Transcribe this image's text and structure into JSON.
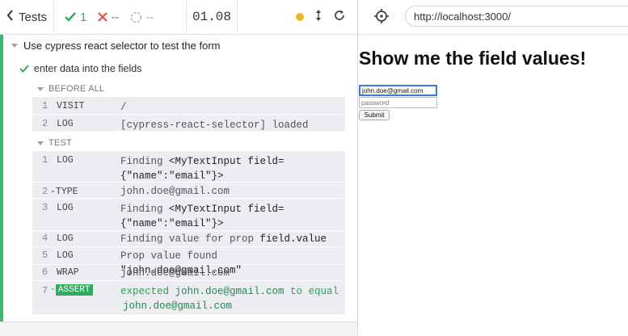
{
  "header": {
    "tests_label": "Tests",
    "passed": "1",
    "failed": "--",
    "pending": "--",
    "duration": "01.08"
  },
  "suite": {
    "title": "Use cypress react selector to test the form",
    "test_title": "enter data into the fields",
    "before_all_label": "BEFORE ALL",
    "test_label": "TEST",
    "before_all": [
      {
        "num": "1",
        "name": "VISIT",
        "message": "/"
      },
      {
        "num": "2",
        "name": "LOG",
        "message": "[cypress-react-selector] loaded"
      }
    ],
    "commands": [
      {
        "num": "1",
        "name": "LOG",
        "message_plain": "Finding ",
        "message_dark": "<MyTextInput field=",
        "message_line2": "{\"name\":\"email\"}>"
      },
      {
        "num": "2",
        "name": "-TYPE",
        "message": "john.doe@gmail.com"
      },
      {
        "num": "3",
        "name": "LOG",
        "message_plain": "Finding ",
        "message_dark": "<MyTextInput field=",
        "message_line2": "{\"name\":\"email\"}>"
      },
      {
        "num": "4",
        "name": "LOG",
        "message_plain": "Finding value for prop ",
        "message_dark": "field.value"
      },
      {
        "num": "5",
        "name": "LOG",
        "message_plain": "Prop value found ",
        "message_dark": "\"john.doe@gmail.com\""
      },
      {
        "num": "6",
        "name": "WRAP",
        "message": "john.doe@gmail.com"
      },
      {
        "num": "7",
        "name": "ASSERT",
        "prefix": "-",
        "message_a": "expected ",
        "message_b": "john.doe@gmail.com",
        "message_c": " to equal",
        "message_line2": "john.doe@gmail.com"
      }
    ]
  },
  "aut": {
    "url": "http://localhost:3000/",
    "heading": "Show me the field values!",
    "email_value": "john.doe@gmail.com",
    "password_placeholder": "password",
    "submit_label": "Submit"
  },
  "colors": {
    "pass": "#2cb15a",
    "fail": "#e0504c",
    "running": "#f0b429"
  },
  "icons": [
    "chevron-left-icon",
    "check-icon",
    "x-icon",
    "circle-dashed-icon",
    "running-dot-icon",
    "updown-arrows-icon",
    "reload-icon",
    "crosshair-icon",
    "triangle-down-icon"
  ]
}
